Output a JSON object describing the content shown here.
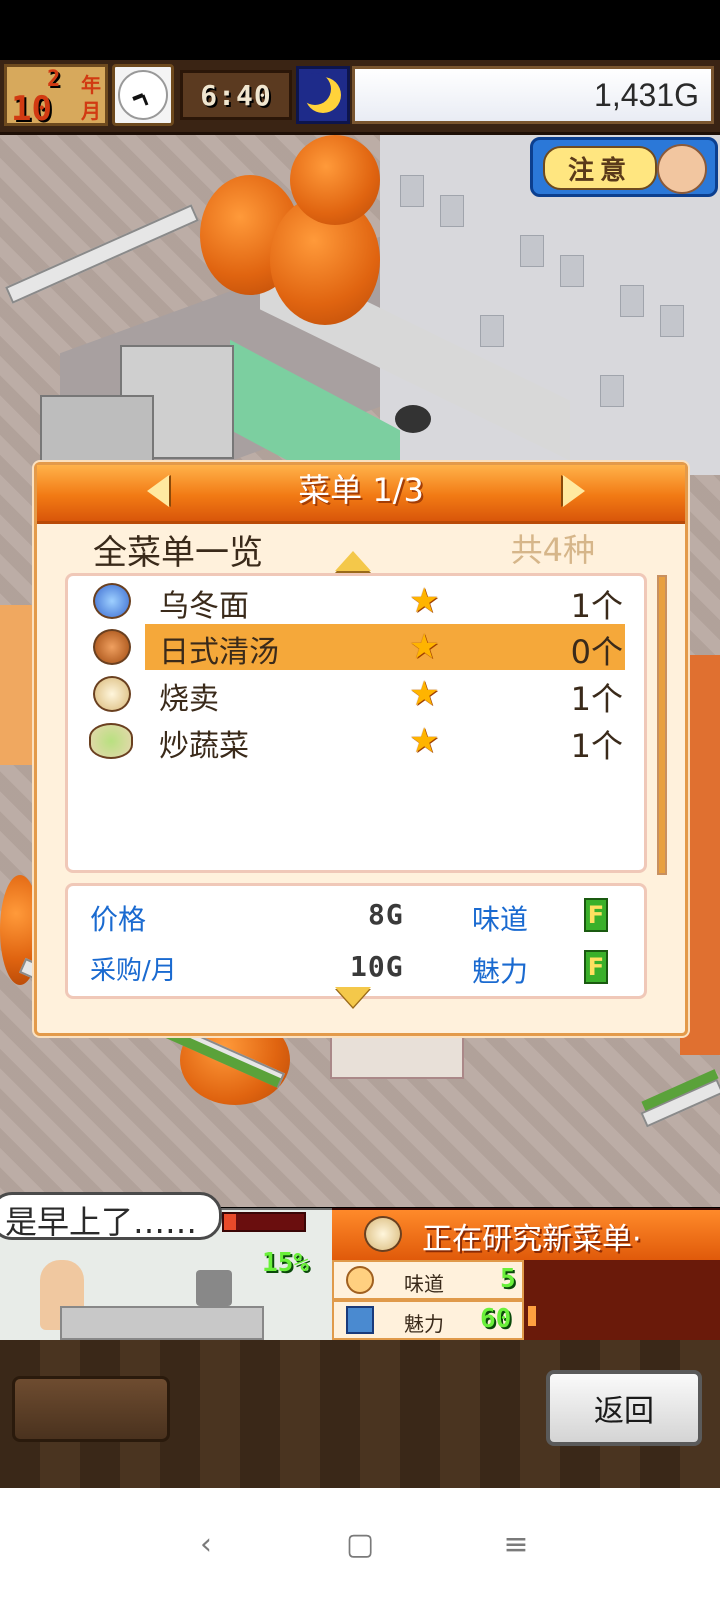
{
  "hud": {
    "year_num": "2",
    "year_unit": "年",
    "month_num": "10",
    "month_unit": "月",
    "time": "6:40",
    "money": "1,431G",
    "warning_label": "注意"
  },
  "menu_dialog": {
    "title": "菜单 1/3",
    "list_title": "全菜单一览",
    "count": "共4种",
    "items": [
      {
        "name": "乌冬面",
        "stars": "★",
        "qty": "1个",
        "icon": "udon-bowl-icon",
        "selected": false
      },
      {
        "name": "日式清汤",
        "stars": "★",
        "qty": "0个",
        "icon": "soup-icon",
        "selected": true
      },
      {
        "name": "烧卖",
        "stars": "★",
        "qty": "1个",
        "icon": "shumai-icon",
        "selected": false
      },
      {
        "name": "炒蔬菜",
        "stars": "★",
        "qty": "1个",
        "icon": "stir-fry-icon",
        "selected": false
      }
    ],
    "info": {
      "price_label": "价格",
      "price_value": "8G",
      "purchase_label": "采购/月",
      "purchase_value": "10G",
      "taste_label": "味道",
      "taste_grade": "F",
      "charm_label": "魅力",
      "charm_grade": "F"
    }
  },
  "bottom": {
    "speech_text": "是早上了……",
    "progress_pct": "15%",
    "progress_value": 0.15,
    "research_title": "正在研究新菜单·",
    "taste_label": "味道",
    "taste_value": "5",
    "charm_label": "魅力",
    "charm_value": "60",
    "back_label": "返回"
  },
  "nav": {
    "back": "‹",
    "home": "▢",
    "menu": "≡"
  },
  "colors": {
    "accent_orange": "#f27a14",
    "link_blue": "#1a6ad0",
    "grade_green": "#3ab02a"
  }
}
